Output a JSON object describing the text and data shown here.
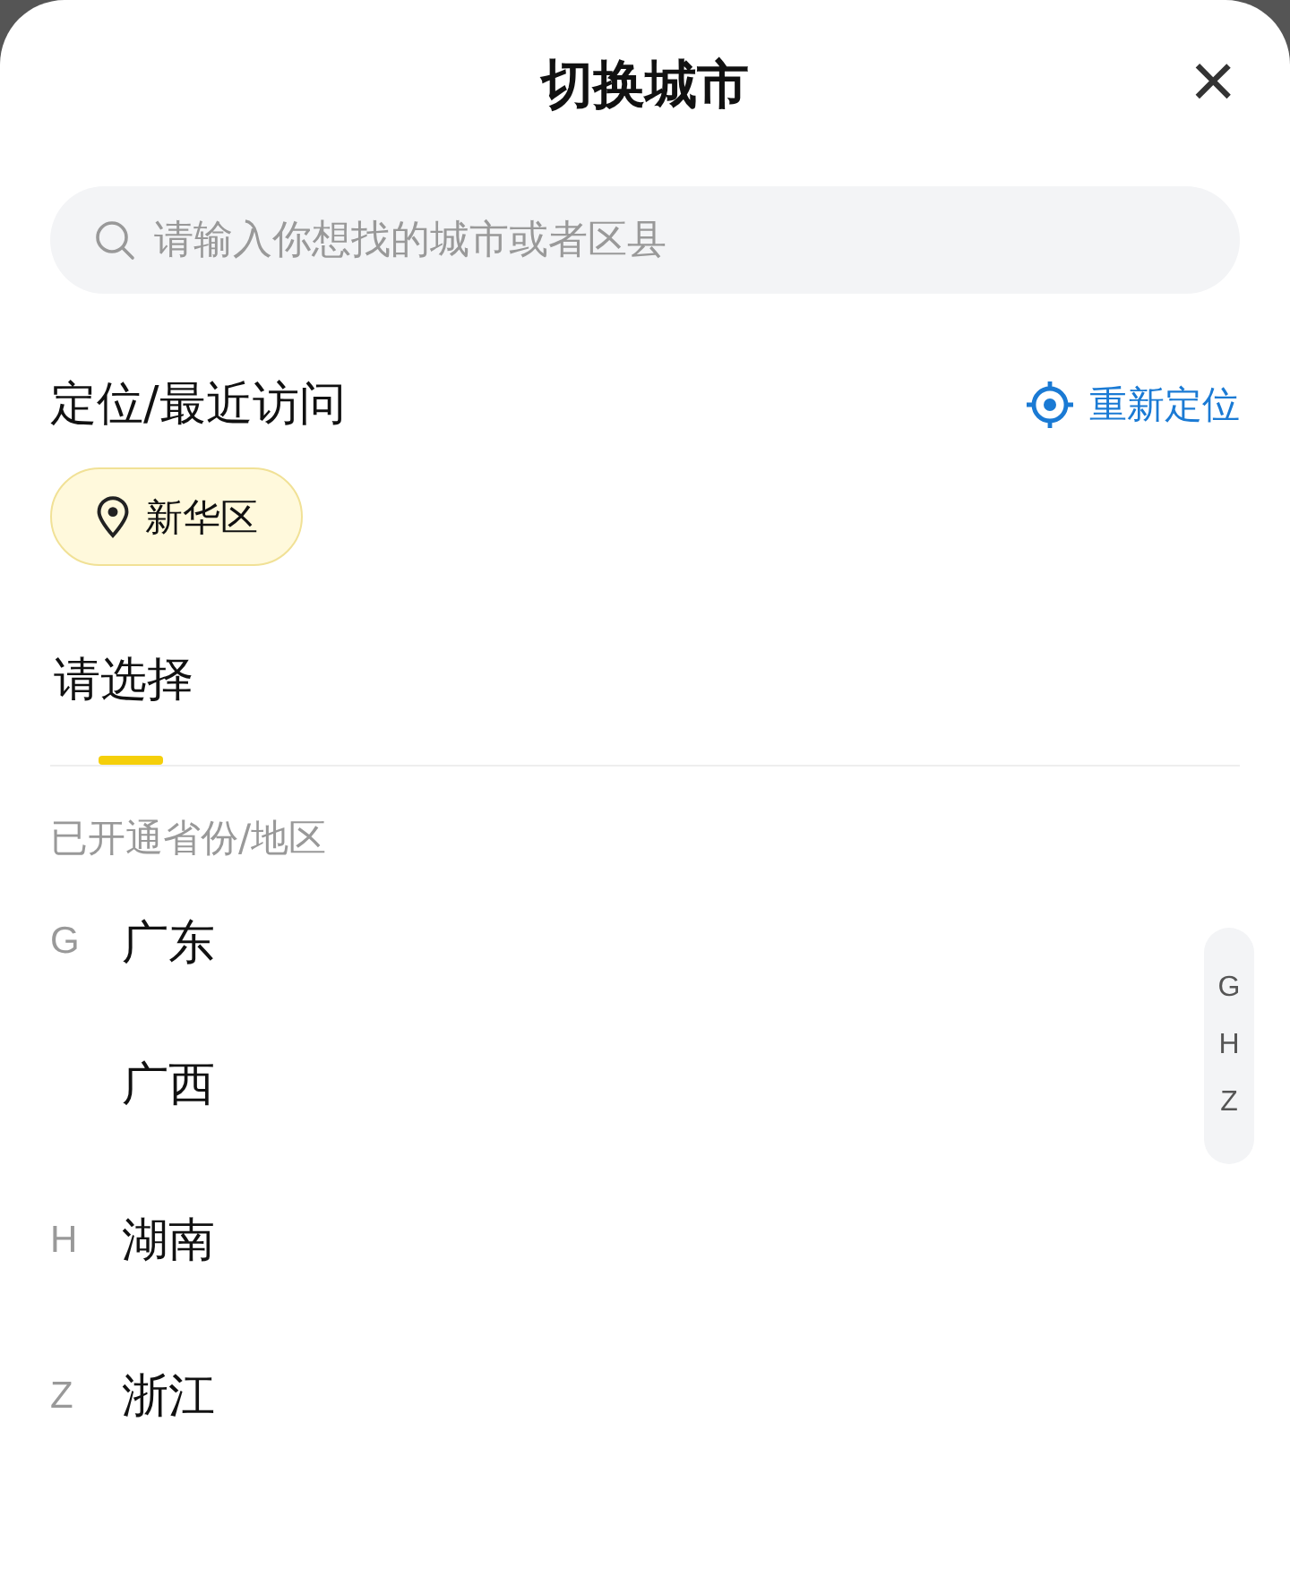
{
  "sheet": {
    "title": "切换城市",
    "close": "×"
  },
  "search": {
    "placeholder": "请输入你想找的城市或者区县"
  },
  "recent": {
    "heading": "定位/最近访问",
    "relocate": "重新定位",
    "chips": [
      "新华区"
    ]
  },
  "tabs": [
    {
      "label": "请选择",
      "selected": true
    }
  ],
  "list": {
    "subtitle": "已开通省份/地区",
    "groups": [
      {
        "letter": "G",
        "items": [
          "广东",
          "广西"
        ]
      },
      {
        "letter": "H",
        "items": [
          "湖南"
        ]
      },
      {
        "letter": "Z",
        "items": [
          "浙江"
        ]
      }
    ]
  },
  "index_bar": [
    "G",
    "H",
    "Z"
  ]
}
